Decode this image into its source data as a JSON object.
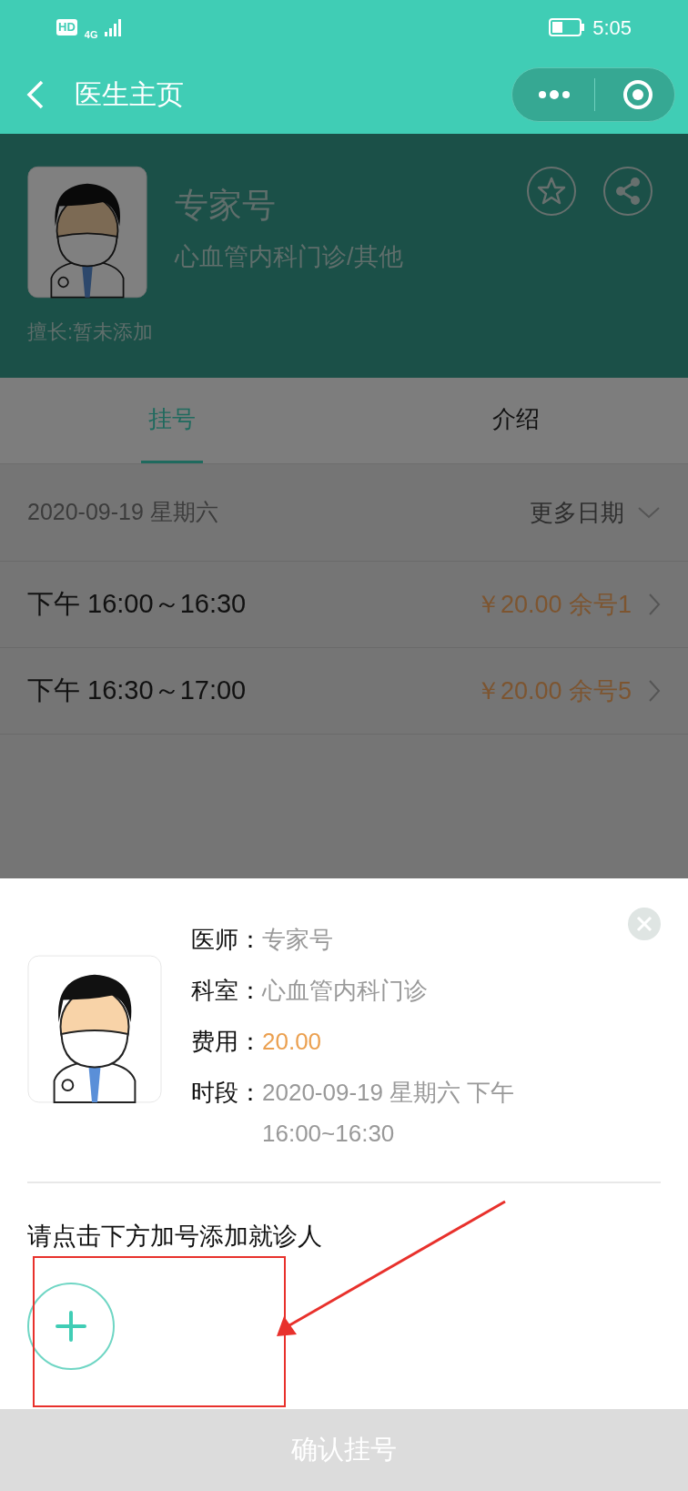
{
  "status_bar": {
    "hd_label": "HD",
    "network_label": "4G",
    "time": "5:05"
  },
  "nav": {
    "title": "医生主页"
  },
  "doctor": {
    "name": "专家号",
    "department": "心血管内科门诊/其他",
    "specialty": "擅长:暂未添加"
  },
  "tabs": [
    {
      "label": "挂号",
      "selected": true
    },
    {
      "label": "介绍",
      "selected": false
    }
  ],
  "date_row": {
    "date": "2020-09-19 星期六",
    "more": "更多日期"
  },
  "slots": [
    {
      "time": "下午 16:00～16:30",
      "price": "￥20.00 余号1"
    },
    {
      "time": "下午 16:30～17:00",
      "price": "￥20.00 余号5"
    }
  ],
  "sheet": {
    "fields": [
      {
        "label": "医师：",
        "value": "专家号",
        "kind": "plain"
      },
      {
        "label": "科室：",
        "value": "心血管内科门诊",
        "kind": "plain"
      },
      {
        "label": "费用：",
        "value": "20.00",
        "kind": "price"
      },
      {
        "label": "时段：",
        "value": "2020-09-19 星期六 下午 16:00~16:30",
        "kind": "plain"
      }
    ],
    "prompt": "请点击下方加号添加就诊人"
  },
  "confirm_button": "确认挂号"
}
